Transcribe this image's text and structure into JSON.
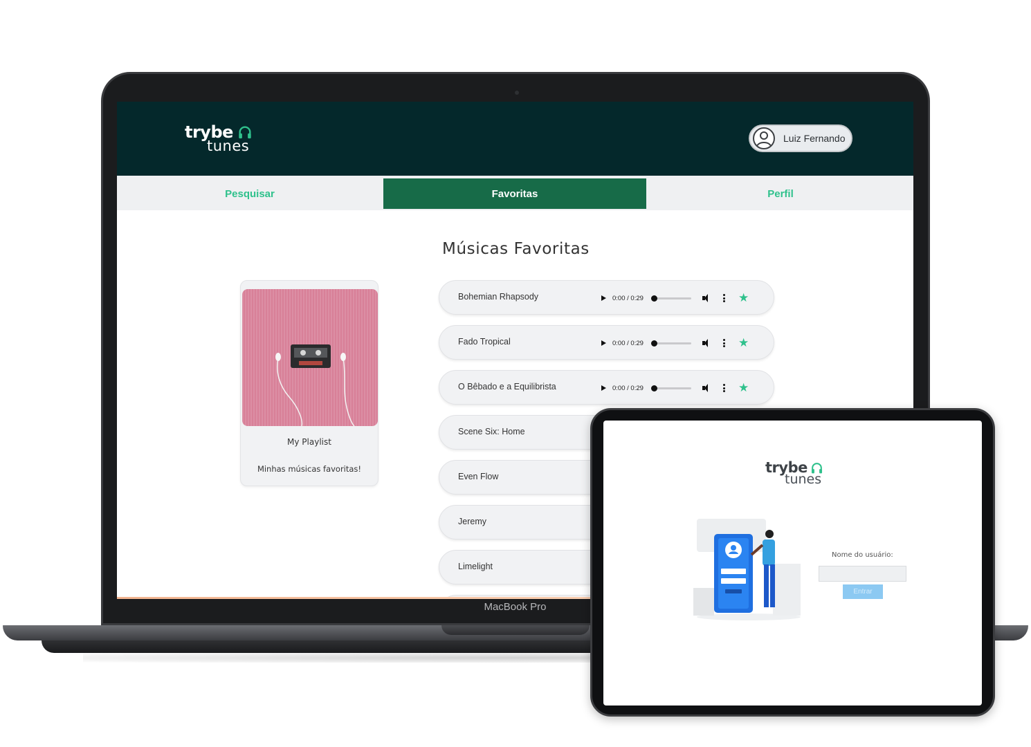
{
  "laptop": {
    "model_label": "MacBook Pro"
  },
  "app": {
    "logo": {
      "top": "trybe",
      "bottom": "tunes"
    },
    "user": {
      "name": "Luiz Fernando"
    },
    "nav": {
      "tabs": [
        {
          "label": "Pesquisar",
          "active": false
        },
        {
          "label": "Favoritas",
          "active": true
        },
        {
          "label": "Perfil",
          "active": false
        }
      ]
    },
    "page_title": "Músicas Favoritas",
    "playlist": {
      "name": "My Playlist",
      "description": "Minhas músicas favoritas!"
    },
    "songs": [
      {
        "title": "Bohemian Rhapsody",
        "time": "0:00 / 0:29",
        "favorite": true
      },
      {
        "title": "Fado Tropical",
        "time": "0:00 / 0:29",
        "favorite": true
      },
      {
        "title": "O Bêbado e a Equilibrista",
        "time": "0:00 / 0:29",
        "favorite": true
      },
      {
        "title": "Scene Six: Home",
        "time": "",
        "favorite": true
      },
      {
        "title": "Even Flow",
        "time": "",
        "favorite": true
      },
      {
        "title": "Jeremy",
        "time": "",
        "favorite": true
      },
      {
        "title": "Limelight",
        "time": "",
        "favorite": true
      }
    ],
    "star_glyph": "★"
  },
  "tablet": {
    "logo": {
      "top": "trybe",
      "bottom": "tunes"
    },
    "login": {
      "username_label": "Nome do usuário:",
      "username_value": "",
      "submit_label": "Entrar"
    }
  },
  "colors": {
    "header_bg": "#04282b",
    "accent_green": "#2fc18c",
    "active_tab_bg": "#176b48",
    "nav_bg": "#eff0f2",
    "login_button": "#8cc9f2"
  }
}
